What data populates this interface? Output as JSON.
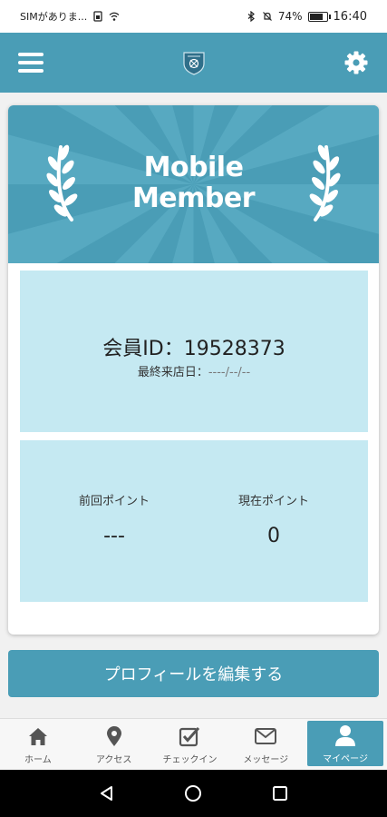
{
  "status_bar": {
    "carrier": "SIMがありま...",
    "battery": "74%",
    "time": "16:40"
  },
  "header": {
    "menu_icon": "hamburger-menu-icon",
    "logo_icon": "shield-crest-icon",
    "settings_icon": "gear-icon"
  },
  "hero": {
    "title_line1": "Mobile",
    "title_line2": "Member"
  },
  "member": {
    "id_label": "会員ID：",
    "id_value": "19528373",
    "last_visit_label": "最終来店日：",
    "last_visit_value": "----/--/--"
  },
  "points": {
    "previous_label": "前回ポイント",
    "previous_value": "---",
    "current_label": "現在ポイント",
    "current_value": "0"
  },
  "profile_button": {
    "label": "プロフィールを編集する"
  },
  "tabs": [
    {
      "label": "ホーム",
      "icon": "home-icon"
    },
    {
      "label": "アクセス",
      "icon": "map-pin-icon"
    },
    {
      "label": "チェックイン",
      "icon": "checkbox-icon"
    },
    {
      "label": "メッセージ",
      "icon": "envelope-icon"
    },
    {
      "label": "マイページ",
      "icon": "user-icon",
      "active": true
    }
  ],
  "colors": {
    "accent": "#4a9db6",
    "panel": "#c5e9f2"
  }
}
